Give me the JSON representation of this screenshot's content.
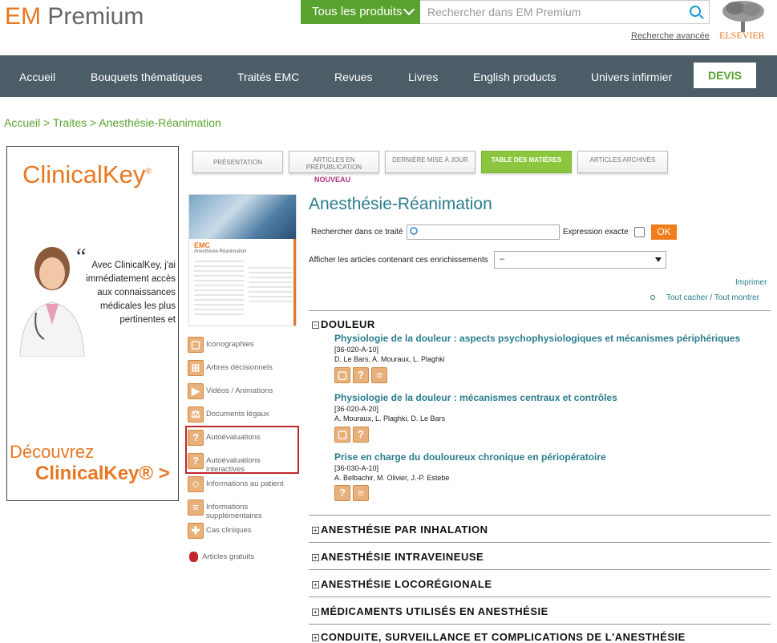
{
  "header": {
    "logo_em": "EM",
    "logo_premium": "Premium",
    "products_button": "Tous les produits",
    "search_placeholder": "Rechercher dans EM Premium",
    "advanced_search": "Recherche avancée",
    "publisher": "ELSEVIER"
  },
  "nav": {
    "items": [
      "Accueil",
      "Bouquets thématiques",
      "Traités EMC",
      "Revues",
      "Livres",
      "English products",
      "Univers infirmier"
    ],
    "devis": "DEVIS"
  },
  "breadcrumb": "Accueil > Traites > Anesthésie-Réanimation",
  "ad": {
    "logo": "ClinicalKey",
    "quote": "Avec ClinicalKey, j'ai immédiatement accès aux connaissances médicales les plus pertinentes et",
    "cta_line1": "Découvrez",
    "cta_line2": "ClinicalKey® >"
  },
  "cover": {
    "emc": "EMC",
    "subtitle": "Anesthésie-Réanimation"
  },
  "enrichments": [
    {
      "label": "Iconographies",
      "icon": "image-icon",
      "glyph": "▢"
    },
    {
      "label": "Arbres décisionnels",
      "icon": "tree-icon",
      "glyph": "⊞"
    },
    {
      "label": "Vidéos / Animations",
      "icon": "video-icon",
      "glyph": "▶"
    },
    {
      "label": "Documents légaux",
      "icon": "scales-icon",
      "glyph": "⚖"
    },
    {
      "label": "Autoévaluations",
      "icon": "question-icon",
      "glyph": "?"
    },
    {
      "label": "Autoévaluations interactives",
      "icon": "question-interactive-icon",
      "glyph": "?"
    },
    {
      "label": "Informations au patient",
      "icon": "patient-icon",
      "glyph": "☺"
    },
    {
      "label": "Informations supplémentaires",
      "icon": "document-icon",
      "glyph": "≡"
    },
    {
      "label": "Cas cliniques",
      "icon": "case-icon",
      "glyph": "✚"
    }
  ],
  "free_articles": "Articles gratuits",
  "tabs": [
    {
      "label": "PRÉSENTATION"
    },
    {
      "label": "ARTICLES EN PRÉPUBLICATION"
    },
    {
      "label": "DERNIÈRE MISE À JOUR"
    },
    {
      "label": "TABLE DES MATIÈRES"
    },
    {
      "label": "ARTICLES ARCHIVÉS"
    }
  ],
  "new_badge": "NOUVEAU",
  "main": {
    "title": "Anesthésie-Réanimation",
    "search_label": "Rechercher dans ce traité",
    "exact_label": "Expression exacte",
    "ok_button": "OK",
    "filter_label": "Afficher les articles contenant ces enrichissements",
    "filter_value": "–",
    "print": "Imprimer",
    "toggle": "Tout cacher / Tout montrer"
  },
  "sections": [
    {
      "toggle": "−",
      "title": "DOULEUR"
    },
    {
      "toggle": "+",
      "title": "ANESTHÉSIE PAR INHALATION"
    },
    {
      "toggle": "+",
      "title": "ANESTHÉSIE INTRAVEINEUSE"
    },
    {
      "toggle": "+",
      "title": "ANESTHÉSIE LOCORÉGIONALE"
    },
    {
      "toggle": "+",
      "title": "MÉDICAMENTS UTILISÉS EN ANESTHÉSIE"
    },
    {
      "toggle": "+",
      "title": "CONDUITE, SURVEILLANCE ET COMPLICATIONS DE L'ANESTHÉSIE"
    }
  ],
  "articles": [
    {
      "title": "Physiologie de la douleur : aspects psychophysiologiques et mécanismes périphériques",
      "ref": "[36-020-A-10]",
      "authors": "D. Le Bars, A. Mouraux, L. Plaghki"
    },
    {
      "title": "Physiologie de la douleur : mécanismes centraux et contrôles",
      "ref": "[36-020-A-20]",
      "authors": "A. Mouraux, L. Plaghki, D. Le Bars"
    },
    {
      "title": "Prise en charge du douloureux chronique en périopératoire",
      "ref": "[36-030-A-10]",
      "authors": "A. Belbachir, M. Olivier, J.-P. Estebe"
    }
  ]
}
